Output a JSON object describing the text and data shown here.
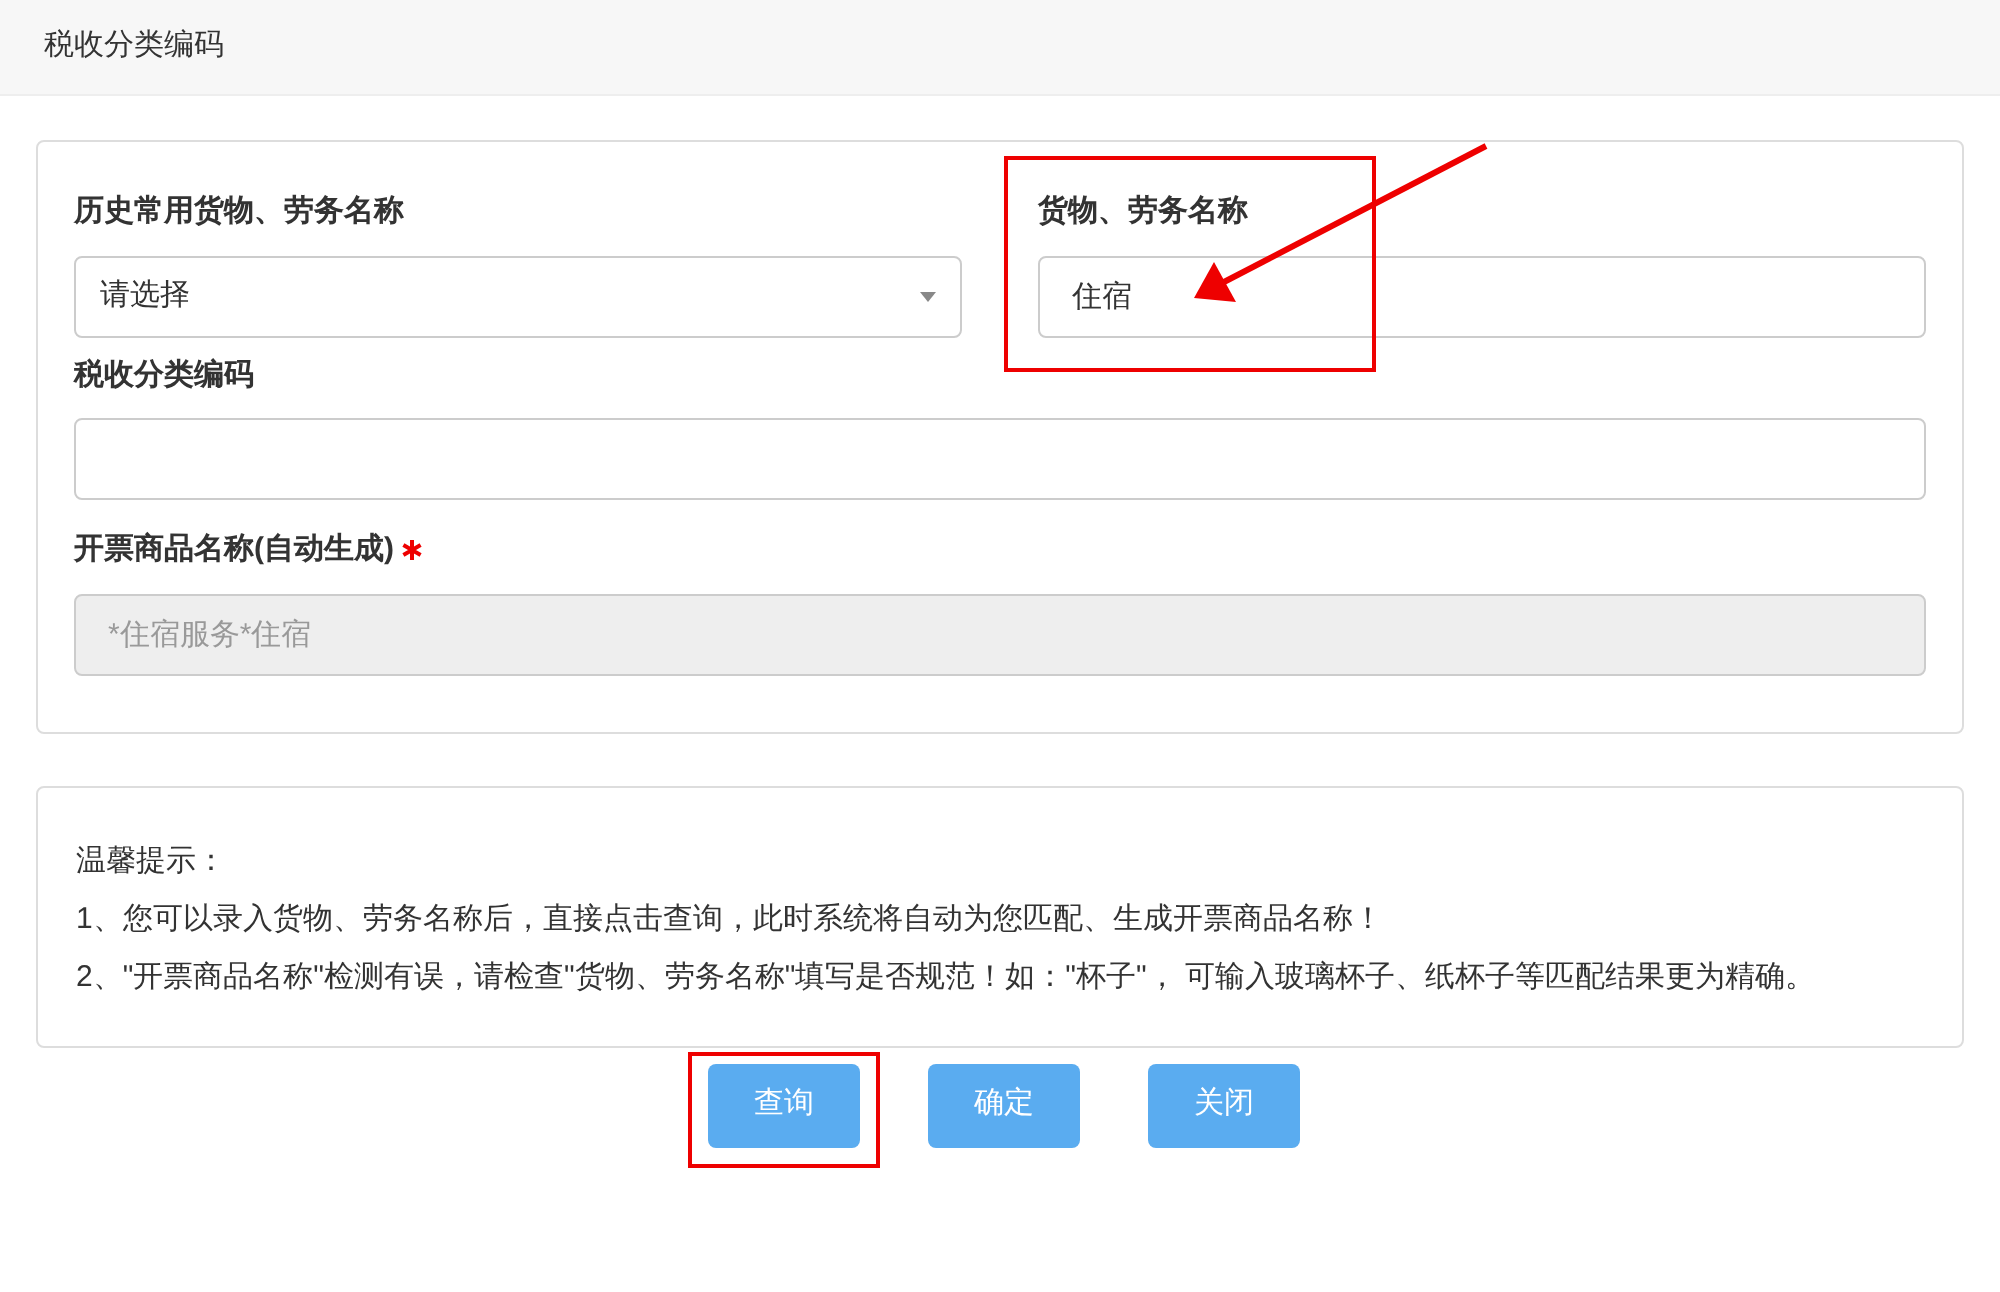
{
  "header": {
    "title": "税收分类编码"
  },
  "form": {
    "history": {
      "label": "历史常用货物、劳务名称",
      "value": "请选择"
    },
    "goods_name": {
      "label": "货物、劳务名称",
      "value": "住宿",
      "highlighted": true,
      "pointed_at": true
    },
    "tax_code": {
      "label": "税收分类编码"
    },
    "invoice_name": {
      "label": "开票商品名称(自动生成)",
      "required": true,
      "value": "*住宿服务*住宿",
      "disabled": true
    }
  },
  "tips": {
    "title": "温馨提示：",
    "lines": [
      "1、您可以录入货物、劳务名称后，直接点击查询，此时系统将自动为您匹配、生成开票商品名称！",
      "2、\"开票商品名称\"检测有误，请检查\"货物、劳务名称\"填写是否规范！如：\"杯子\"， 可输入玻璃杯子、纸杯子等匹配结果更为精确。"
    ]
  },
  "buttons": [
    {
      "label": "查询",
      "highlighted": true
    },
    {
      "label": "确定",
      "highlighted": false
    },
    {
      "label": "关闭",
      "highlighted": false
    }
  ]
}
